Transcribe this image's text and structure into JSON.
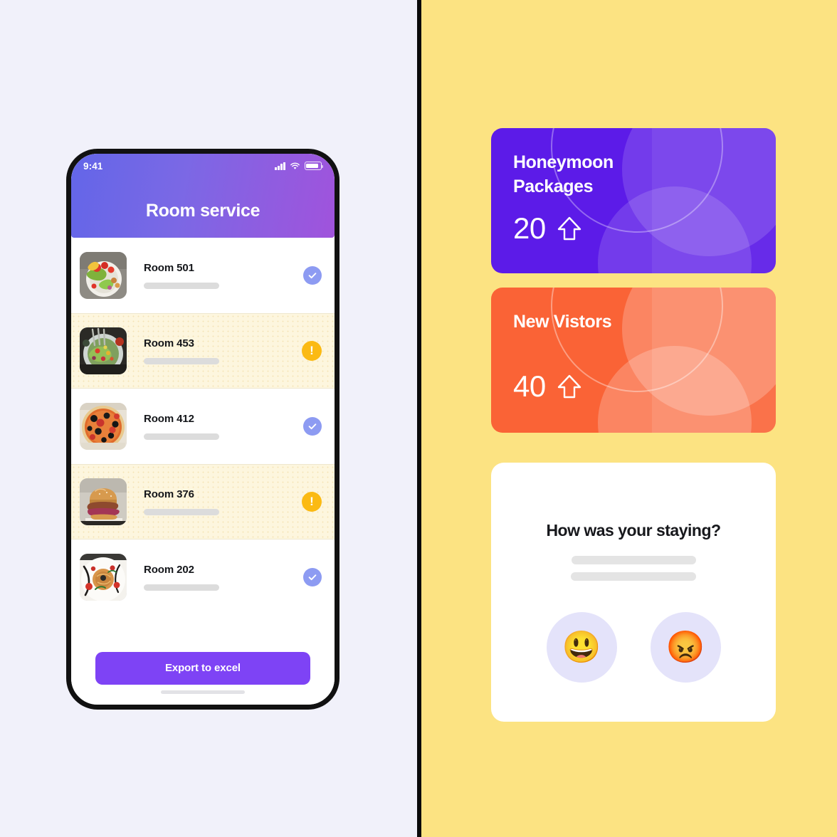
{
  "layout": {
    "left_bg": "#F1F1FA",
    "right_bg": "#FCE382",
    "divider_color": "#0A0A0A"
  },
  "phone": {
    "status_bar": {
      "time": "9:41",
      "signal_icon": "cellular-signal-icon",
      "wifi_icon": "wifi-icon",
      "battery_icon": "battery-icon"
    },
    "header": {
      "title": "Room service",
      "gradient_from": "#6366E8",
      "gradient_to": "#A053DC"
    },
    "rooms": [
      {
        "name": "Room 501",
        "status": "ok",
        "badge_icon": "check-circle-icon",
        "thumb": "salad-bowl-photo",
        "flagged": false
      },
      {
        "name": "Room 453",
        "status": "warn",
        "badge_icon": "alert-circle-icon",
        "thumb": "green-salad-plate-photo",
        "flagged": true
      },
      {
        "name": "Room 412",
        "status": "ok",
        "badge_icon": "check-circle-icon",
        "thumb": "pizza-photo",
        "flagged": false
      },
      {
        "name": "Room 376",
        "status": "warn",
        "badge_icon": "alert-circle-icon",
        "thumb": "burger-photo",
        "flagged": true
      },
      {
        "name": "Room 202",
        "status": "ok",
        "badge_icon": "check-circle-icon",
        "thumb": "pasta-plate-photo",
        "flagged": false
      }
    ],
    "export_button": {
      "label": "Export  to excel",
      "color": "#7E43F5"
    },
    "home_indicator": "home-indicator"
  },
  "dashboard": {
    "cards": [
      {
        "title": "Honeymoon\nPackages",
        "value": "20",
        "trend_icon": "arrow-up-icon",
        "color": "#5C1BE8"
      },
      {
        "title": "New Vistors",
        "value": "40",
        "trend_icon": "arrow-up-icon",
        "color": "#FA6336"
      }
    ],
    "feedback": {
      "title": "How was your staying?",
      "options": [
        {
          "icon": "grinning-face-emoji",
          "glyph": "😃"
        },
        {
          "icon": "angry-face-emoji",
          "glyph": "😡"
        }
      ]
    }
  }
}
